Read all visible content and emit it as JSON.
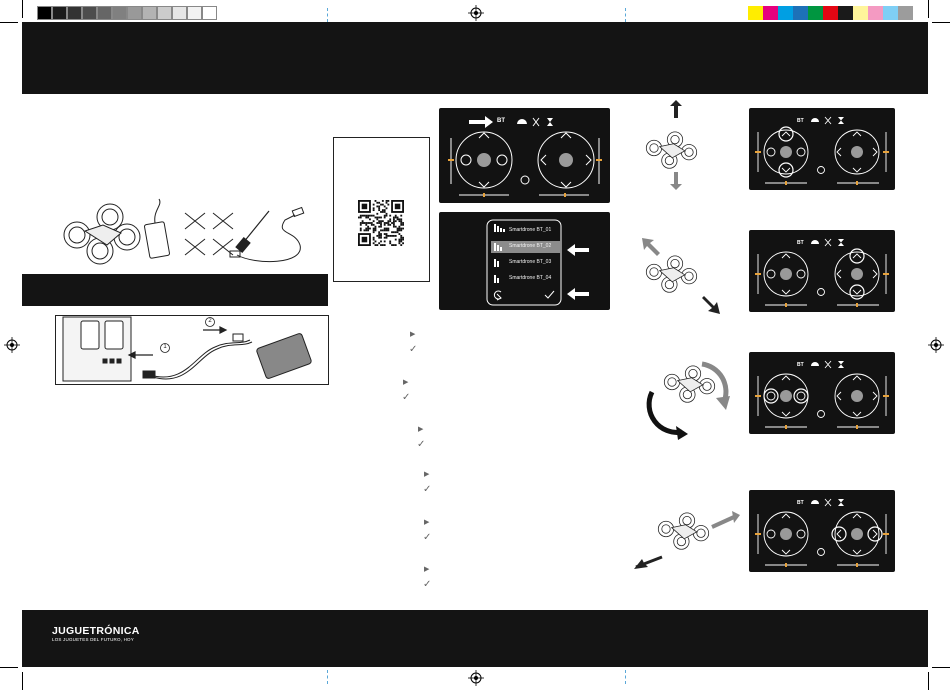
{
  "color_bar": {
    "grays": [
      "#000000",
      "#1c1c1c",
      "#333333",
      "#4d4d4d",
      "#666666",
      "#808080",
      "#999999",
      "#b3b3b3",
      "#cccccc",
      "#e6e6e6",
      "#f2f2f2",
      "#ffffff"
    ],
    "process": [
      "#ffed00",
      "#e6007e",
      "#009fe3",
      "#1d71b8",
      "#009640",
      "#e30613",
      "#1a1a1a",
      "#fff59b",
      "#f49ac2",
      "#7fcff5",
      "#9c9c9c"
    ]
  },
  "connection_screen": {
    "bt_label": "BT",
    "devices": [
      "Smartdrone BT_01",
      "Smartdrone BT_02",
      "Smartdrone BT_03",
      "Smartdrone BT_04"
    ]
  },
  "controller_panels": [
    {
      "bt_label": "BT"
    },
    {
      "bt_label": "BT"
    },
    {
      "bt_label": "BT"
    },
    {
      "bt_label": "BT"
    }
  ],
  "step_markers": {
    "play": "▶",
    "check": "✓"
  },
  "charging": {
    "step1": "1",
    "step2": "2"
  },
  "footer": {
    "brand": "JUGUETRÓNICA",
    "tagline": "LOS JUGUETES DEL FUTURO, HOY"
  },
  "colors": {
    "dark": "#141414",
    "accent_orange": "#e8a33c",
    "gray_knob": "#9a9a9a"
  }
}
